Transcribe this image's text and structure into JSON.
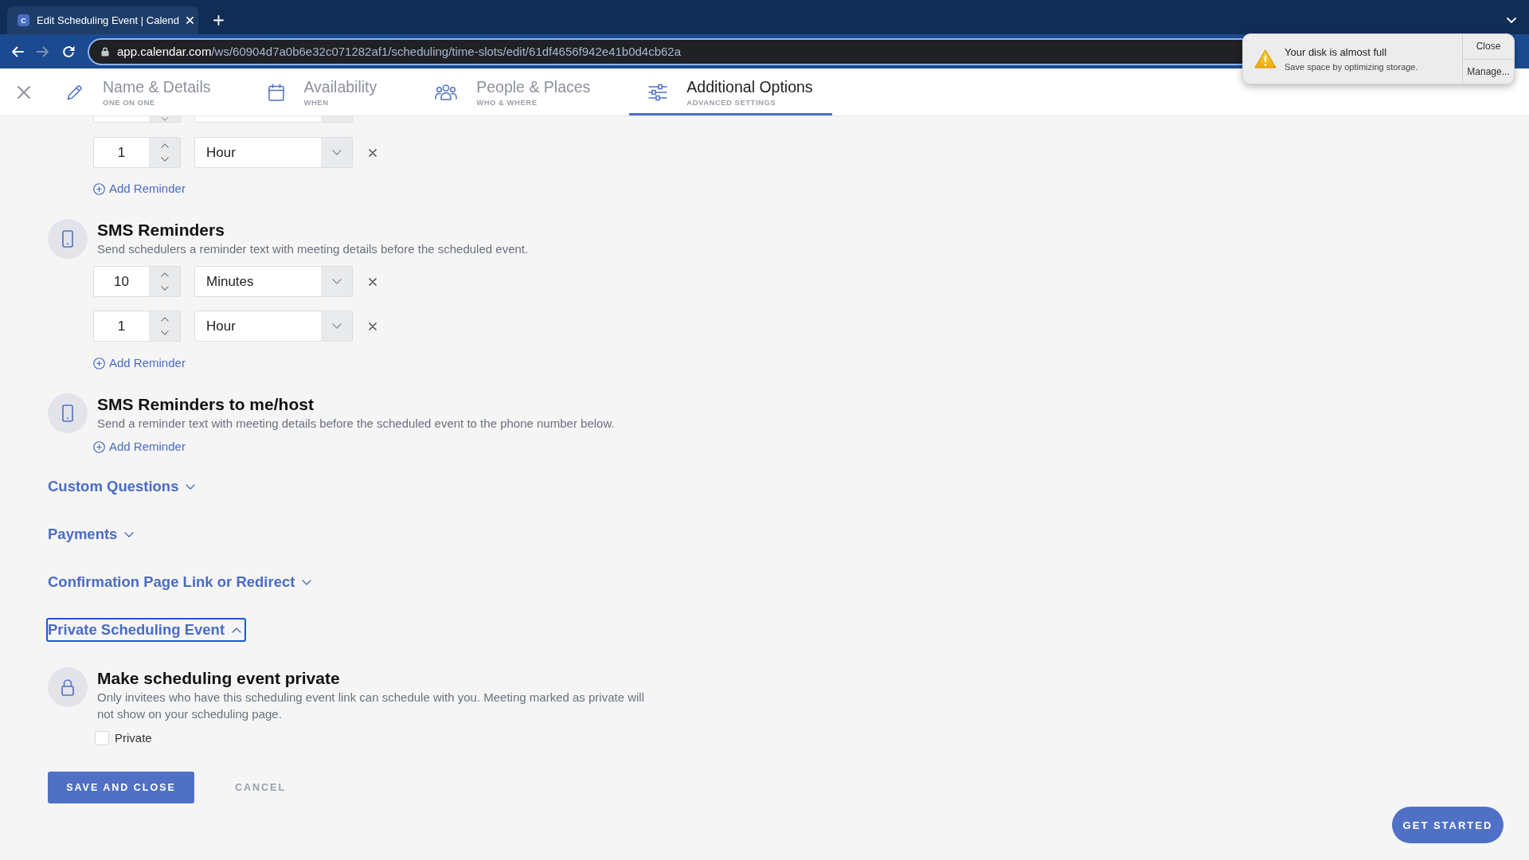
{
  "browser": {
    "tab": {
      "favicon_letter": "C",
      "title": "Edit Scheduling Event | Calend"
    },
    "nav_buttons": [
      {
        "kind": "back",
        "disabled": false
      },
      {
        "kind": "forward",
        "disabled": true
      },
      {
        "kind": "reload",
        "disabled": false
      }
    ],
    "url": {
      "host": "app.calendar.com",
      "path": "/ws/60904d7a0b6e32c071282af1/scheduling/time-slots/edit/61df4656f942e41b0d4cb62a"
    }
  },
  "notification": {
    "title": "Your disk is almost full",
    "message": "Save space by optimizing storage.",
    "buttons": [
      "Close",
      "Manage..."
    ]
  },
  "steps": [
    {
      "kind": "details",
      "label": "Name & Details",
      "sublabel": "ONE ON ONE",
      "selected": false
    },
    {
      "kind": "availability",
      "label": "Availability",
      "sublabel": "WHEN",
      "selected": false
    },
    {
      "kind": "people",
      "label": "People & Places",
      "sublabel": "WHO & WHERE",
      "selected": false
    },
    {
      "kind": "options",
      "label": "Additional Options",
      "sublabel": "ADVANCED SETTINGS",
      "selected": true
    }
  ],
  "upper_reminders": {
    "rows": [
      {
        "partial": true
      },
      {
        "partial": false,
        "value": "1",
        "unit": "Hour"
      }
    ],
    "add_label": "Add Reminder"
  },
  "sections": [
    {
      "kind": "sms",
      "title": "SMS Reminders",
      "description": "Send schedulers a reminder text with meeting details before the scheduled event.",
      "rows": [
        {
          "partial": false,
          "value": "10",
          "unit": "Minutes"
        },
        {
          "partial": false,
          "value": "1",
          "unit": "Hour"
        }
      ],
      "add_label": "Add Reminder"
    },
    {
      "kind": "sms",
      "title": "SMS Reminders to me/host",
      "description": "Send a reminder text with meeting details before the scheduled event to the phone number below.",
      "add_label": "Add Reminder"
    }
  ],
  "accordions": [
    {
      "title": "Custom Questions",
      "expanded": false,
      "focused": false
    },
    {
      "title": "Payments",
      "expanded": false,
      "focused": false
    },
    {
      "title": "Confirmation Page Link or Redirect",
      "expanded": false,
      "focused": false
    },
    {
      "title": "Private Scheduling Event",
      "expanded": true,
      "focused": true,
      "content": {
        "kind": "privacy",
        "title": "Make scheduling event private",
        "description": "Only invitees who have this scheduling event link can schedule with you. Meeting marked as private will not show on your scheduling page.",
        "checkbox": {
          "label": "Private",
          "checked": false
        }
      }
    }
  ],
  "actions": {
    "save": "SAVE AND CLOSE",
    "cancel": "CANCEL"
  },
  "help_button": "GET STARTED"
}
